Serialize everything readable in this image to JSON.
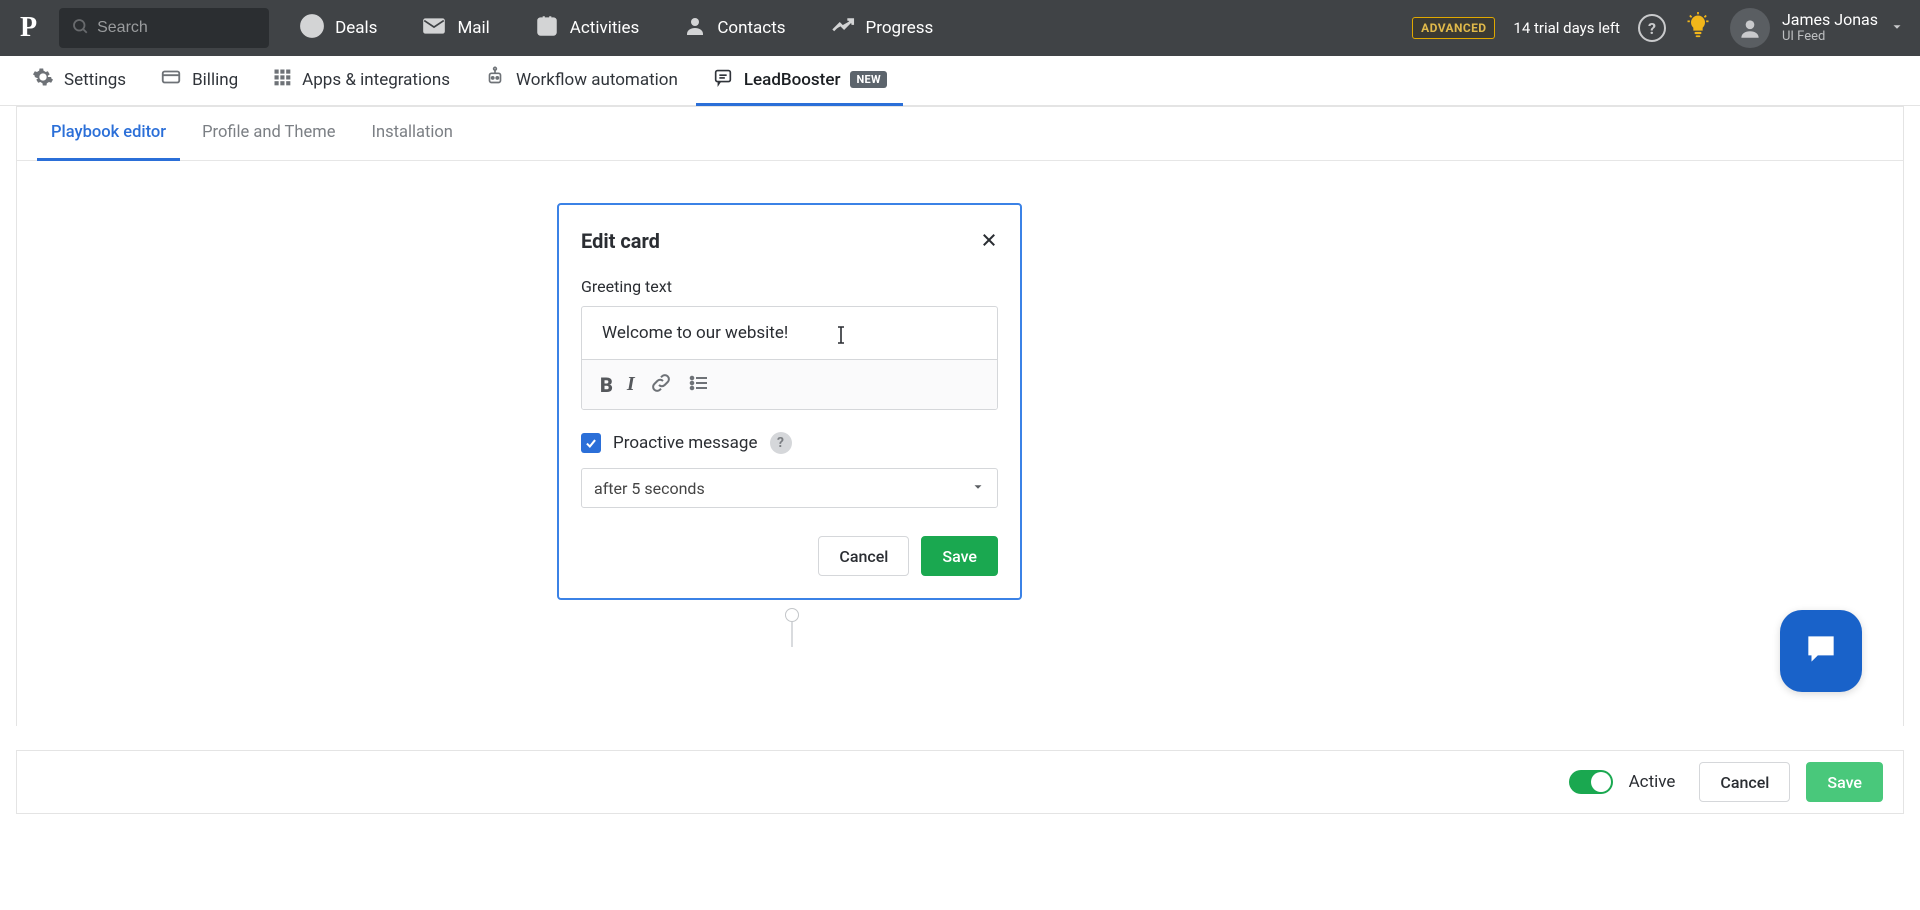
{
  "header": {
    "search_placeholder": "Search",
    "nav": [
      {
        "label": "Deals"
      },
      {
        "label": "Mail"
      },
      {
        "label": "Activities"
      },
      {
        "label": "Contacts"
      },
      {
        "label": "Progress"
      }
    ],
    "badge": "ADVANCED",
    "trial": "14 trial days left",
    "user_name": "James Jonas",
    "user_role": "UI Feed"
  },
  "settings_tabs": [
    {
      "label": "Settings"
    },
    {
      "label": "Billing"
    },
    {
      "label": "Apps & integrations"
    },
    {
      "label": "Workflow automation"
    },
    {
      "label": "LeadBooster",
      "badge": "NEW"
    }
  ],
  "sub_tabs": [
    {
      "label": "Playbook editor"
    },
    {
      "label": "Profile and Theme"
    },
    {
      "label": "Installation"
    }
  ],
  "card": {
    "title": "Edit card",
    "greeting_label": "Greeting text",
    "greeting_value": "Welcome to our website!",
    "proactive_label": "Proactive message",
    "proactive_checked": true,
    "delay_selected": "after 5 seconds",
    "cancel_label": "Cancel",
    "save_label": "Save"
  },
  "bottom": {
    "active_label": "Active",
    "cancel_label": "Cancel",
    "save_label": "Save"
  }
}
